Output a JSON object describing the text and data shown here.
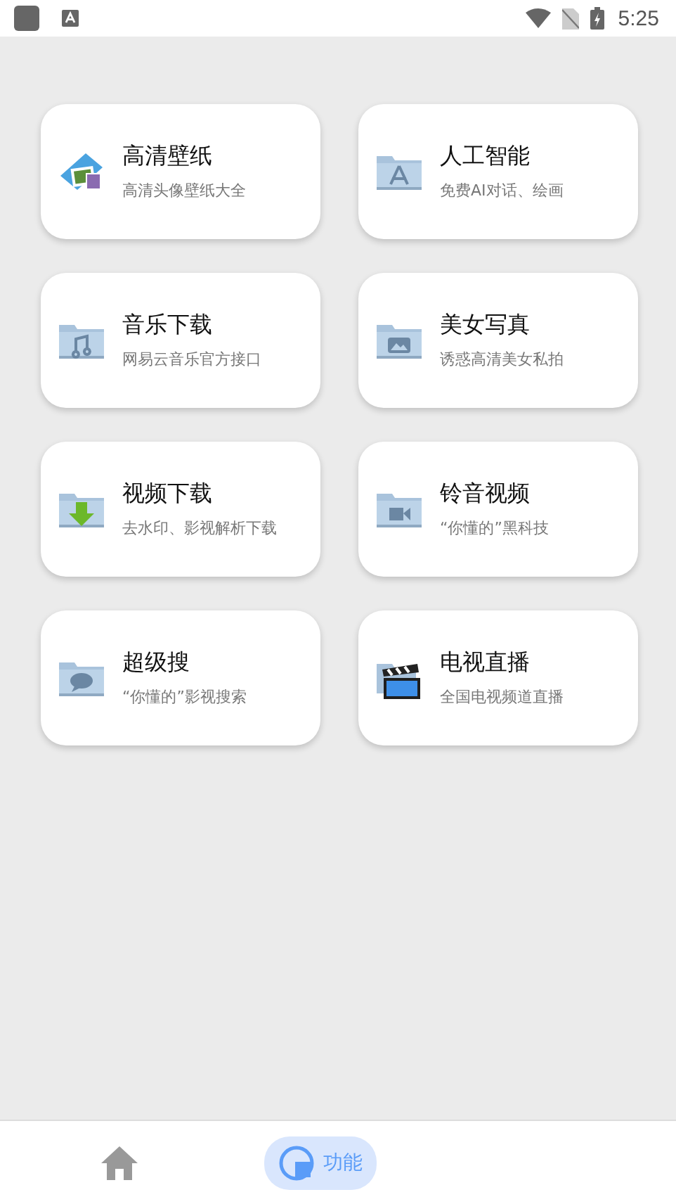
{
  "status_bar": {
    "time": "5:25"
  },
  "cards": [
    {
      "title": "高清壁纸",
      "subtitle": "高清头像壁纸大全"
    },
    {
      "title": "人工智能",
      "subtitle": "免费AI对话、绘画"
    },
    {
      "title": "音乐下载",
      "subtitle": "网易云音乐官方接口"
    },
    {
      "title": "美女写真",
      "subtitle": "诱惑高清美女私拍"
    },
    {
      "title": "视频下载",
      "subtitle": "去水印、影视解析下载"
    },
    {
      "title": "铃音视频",
      "subtitle": "“你懂的”黑科技"
    },
    {
      "title": "超级搜",
      "subtitle": "“你懂的”影视搜索"
    },
    {
      "title": "电视直播",
      "subtitle": "全国电视频道直播"
    }
  ],
  "bottom_nav": [
    {
      "kind": "home",
      "selected": false
    },
    {
      "kind": "feature",
      "label": "功能",
      "selected": true
    }
  ]
}
